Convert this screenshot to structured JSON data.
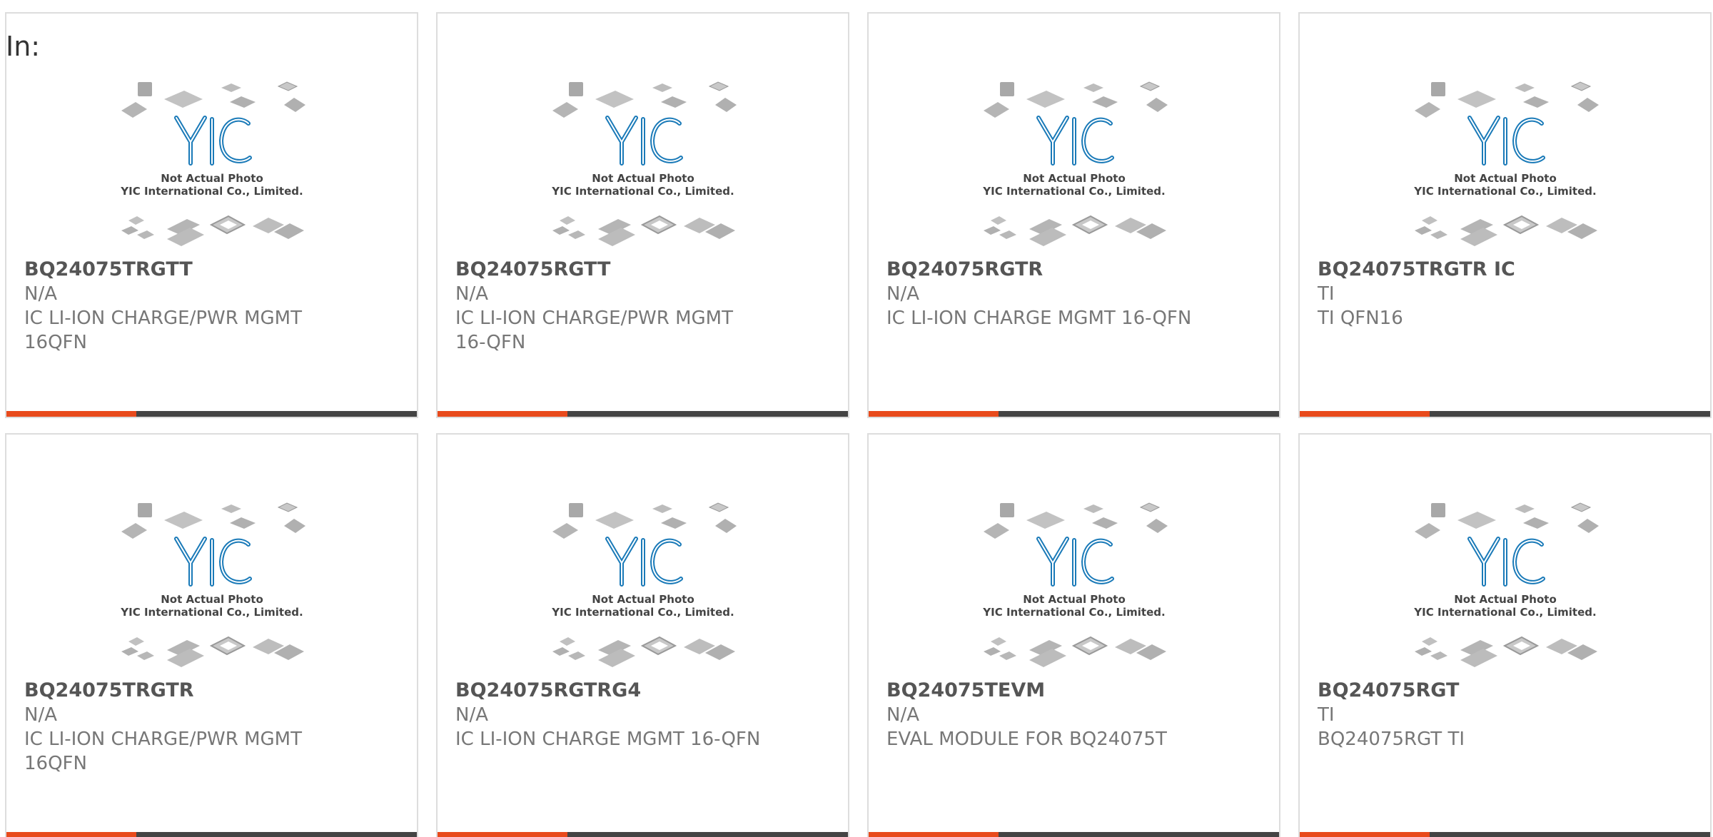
{
  "filter_label": "In:",
  "placeholder": {
    "line1": "Not Actual Photo",
    "line2": "YIC International Co., Limited."
  },
  "colors": {
    "accent": "#e84a1c",
    "bar": "#444444",
    "logo": "#1a7ab8"
  },
  "products": [
    {
      "part": "BQ24075TRGTT",
      "manufacturer": "N/A",
      "description": "IC LI-ION CHARGE/PWR MGMT 16QFN"
    },
    {
      "part": "BQ24075RGTT",
      "manufacturer": "N/A",
      "description": "IC LI-ION CHARGE/PWR MGMT 16-QFN"
    },
    {
      "part": "BQ24075RGTR",
      "manufacturer": "N/A",
      "description": "IC LI-ION CHARGE MGMT 16-QFN"
    },
    {
      "part": "BQ24075TRGTR IC",
      "manufacturer": "TI",
      "description": "TI QFN16"
    },
    {
      "part": "BQ24075TRGTR",
      "manufacturer": "N/A",
      "description": "IC LI-ION CHARGE/PWR MGMT 16QFN"
    },
    {
      "part": "BQ24075RGTRG4",
      "manufacturer": "N/A",
      "description": "IC LI-ION CHARGE MGMT 16-QFN"
    },
    {
      "part": "BQ24075TEVM",
      "manufacturer": "N/A",
      "description": "EVAL MODULE FOR BQ24075T"
    },
    {
      "part": "BQ24075RGT",
      "manufacturer": "TI",
      "description": "BQ24075RGT TI"
    }
  ]
}
